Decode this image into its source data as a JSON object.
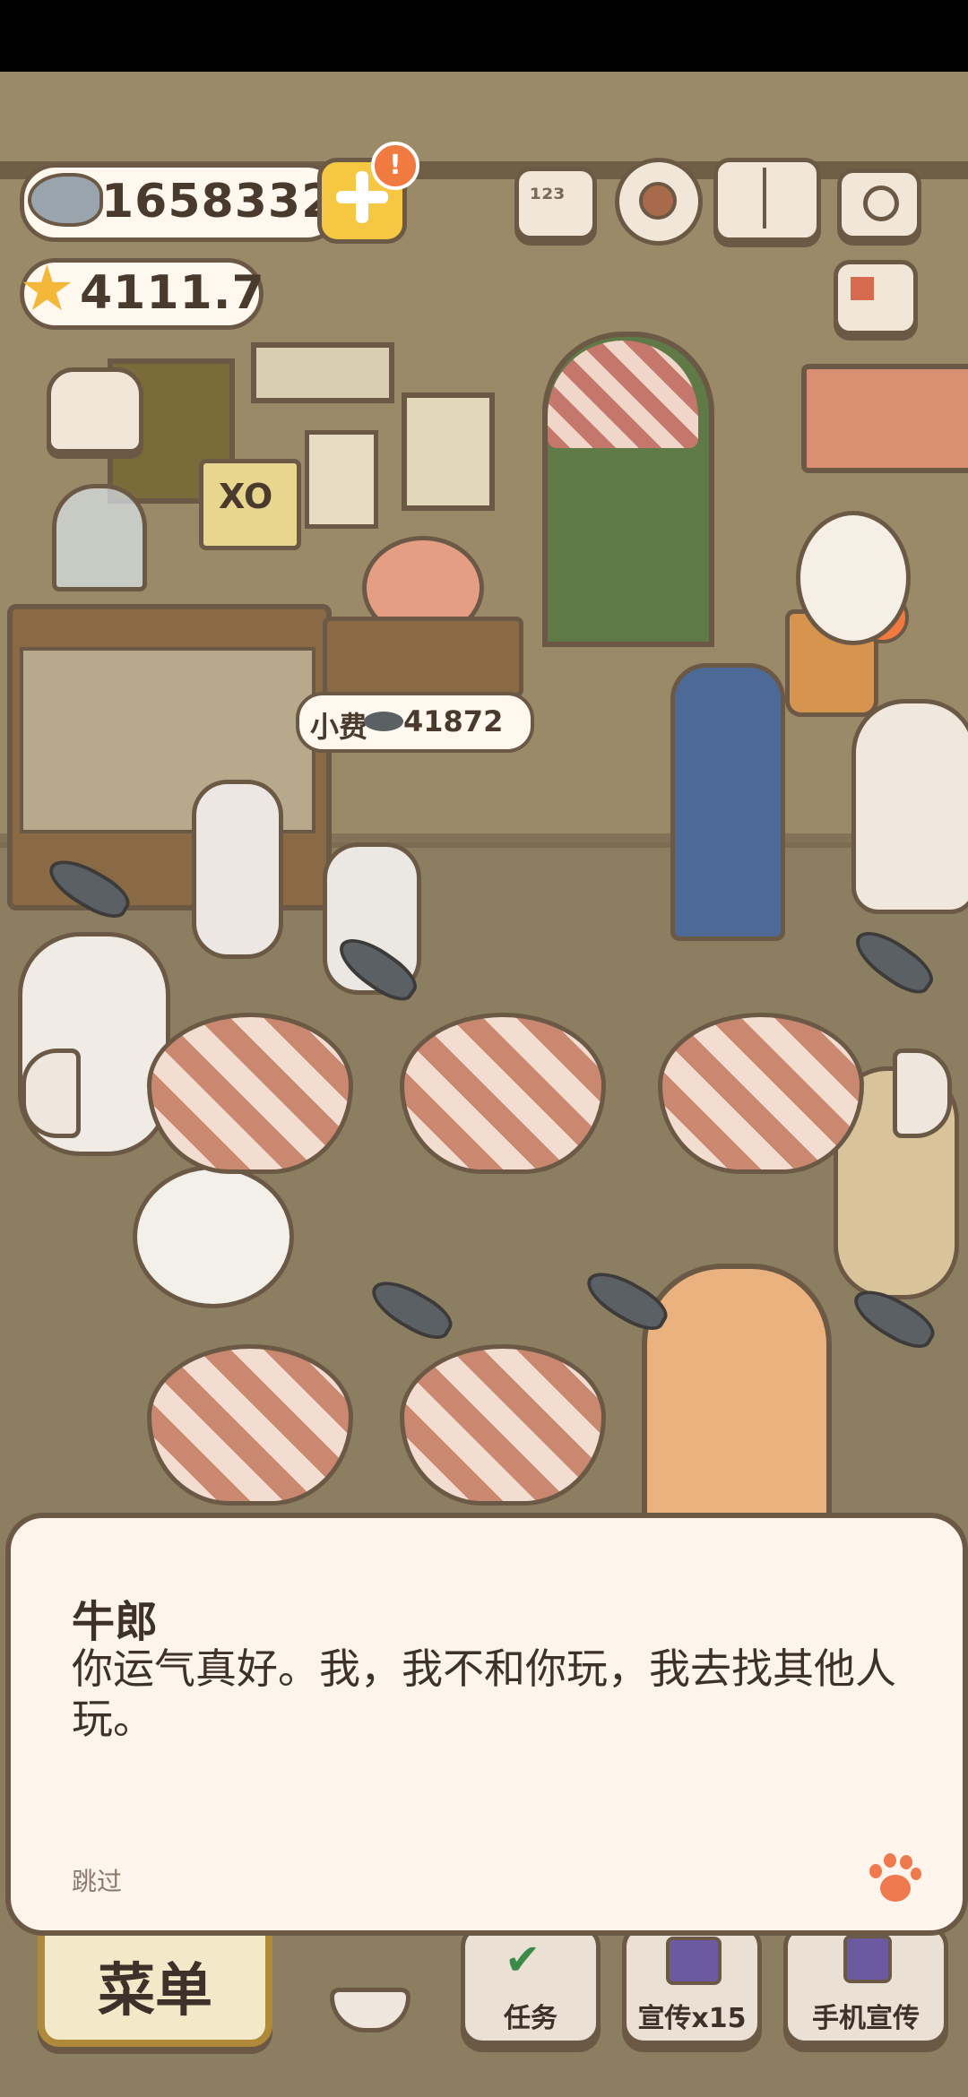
{
  "currency": {
    "fish_count": "1658332",
    "star_count": "4111.7",
    "add_badge": "!"
  },
  "scene": {
    "tip_label": "小费",
    "tip_value": "41872",
    "board_text": "XO"
  },
  "dialog": {
    "speaker": "牛郎",
    "text": "你运气真好。我，我不和你玩，我去找其他人玩。",
    "skip": "跳过"
  },
  "bottom": {
    "menu_label": "菜单",
    "tasks_label": "任务",
    "promo_label": "宣传x15",
    "phone_promo_label": "手机宣传"
  },
  "colors": {
    "outline": "#6b5946",
    "dialog_bg": "#fdf5ec",
    "accent_yellow": "#f6c742",
    "badge_orange": "#f07a3f"
  }
}
